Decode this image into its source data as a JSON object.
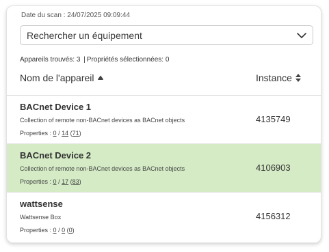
{
  "scan": {
    "date_label": "Date du scan : 24/07/2025 09:09:44"
  },
  "search": {
    "placeholder": "Rechercher un équipement",
    "icon": "chevron-down-icon"
  },
  "summary": {
    "found_label": "Appareils trouvés:",
    "found_count": "3",
    "separator": "|",
    "selected_label": "Propriétés sélectionnées:",
    "selected_count": "0"
  },
  "table": {
    "columns": [
      {
        "label": "Nom de l'appareil",
        "icon": "sort-ascending-icon"
      },
      {
        "label": "Instance",
        "icon": "sort-both-icon"
      }
    ],
    "rows": [
      {
        "name": "BACnet Device 1",
        "description": "Collection of remote non-BACnet devices as BACnet objects",
        "properties_label": "Properties :",
        "selected": "0",
        "slash": "/",
        "count": "14",
        "total": "71",
        "instance": "4135749",
        "highlighted": false
      },
      {
        "name": "BACnet Device 2",
        "description": "Collection of remote non-BACnet devices as BACnet objects",
        "properties_label": "Properties :",
        "selected": "0",
        "slash": "/",
        "count": "17",
        "total": "83",
        "instance": "4106903",
        "highlighted": true
      },
      {
        "name": "wattsense",
        "description": "Wattsense Box",
        "properties_label": "Properties :",
        "selected": "0",
        "slash": "/",
        "count": "0",
        "total": "0",
        "instance": "4156312",
        "highlighted": false
      }
    ]
  },
  "colors": {
    "highlight_row": "#d4ebc5",
    "text": "#333333",
    "border": "#c9c9c9"
  }
}
